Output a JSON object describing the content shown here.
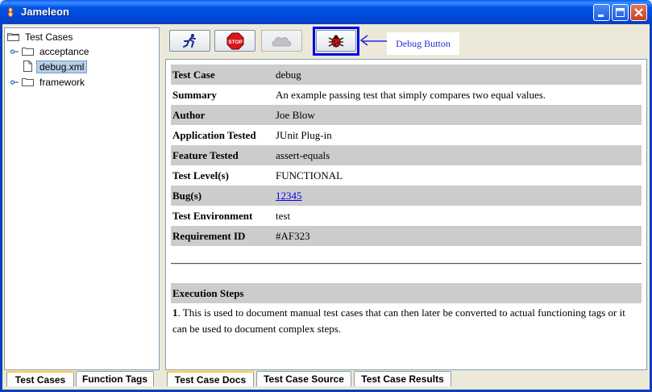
{
  "window": {
    "title": "Jameleon"
  },
  "tree": {
    "root": "Test Cases",
    "items": [
      {
        "label": "acceptance",
        "kind": "folder"
      },
      {
        "label": "debug.xml",
        "kind": "file",
        "selected": true
      },
      {
        "label": "framework",
        "kind": "folder"
      }
    ]
  },
  "left_tabs": [
    {
      "label": "Test Cases",
      "active": true
    },
    {
      "label": "Function Tags",
      "active": false
    }
  ],
  "toolbar": {
    "buttons": [
      {
        "name": "run",
        "icon": "running-man-icon"
      },
      {
        "name": "stop",
        "icon": "stop-sign-icon",
        "text": "STOP"
      },
      {
        "name": "disabled",
        "icon": "cloud-icon"
      },
      {
        "name": "debug",
        "icon": "bug-icon"
      }
    ]
  },
  "annotation": {
    "label": "Debug Button"
  },
  "details": {
    "rows": [
      {
        "key": "Test Case",
        "value": "debug"
      },
      {
        "key": "Summary",
        "value": "An example passing test that simply compares two equal values."
      },
      {
        "key": "Author",
        "value": "Joe Blow"
      },
      {
        "key": "Application Tested",
        "value": "JUnit Plug-in"
      },
      {
        "key": "Feature Tested",
        "value": "assert-equals"
      },
      {
        "key": "Test Level(s)",
        "value": "FUNCTIONAL"
      },
      {
        "key": "Bug(s)",
        "value": "12345"
      },
      {
        "key": "Test Environment",
        "value": "test"
      },
      {
        "key": "Requirement ID",
        "value": "#AF323"
      }
    ],
    "steps_heading": "Execution Steps",
    "step_number": "1",
    "step_text": ". This is used to document manual test cases that can then later be converted to actual functioning tags or it can be used to document complex steps."
  },
  "bottom_tabs": [
    {
      "label": "Test Case Docs",
      "active": true
    },
    {
      "label": "Test Case Source",
      "active": false
    },
    {
      "label": "Test Case Results",
      "active": false
    }
  ],
  "colors": {
    "title_bar": "#0055e5",
    "row_shade": "#cccccc",
    "highlight": "#0000ee",
    "callout_text": "#2a2ad8"
  }
}
